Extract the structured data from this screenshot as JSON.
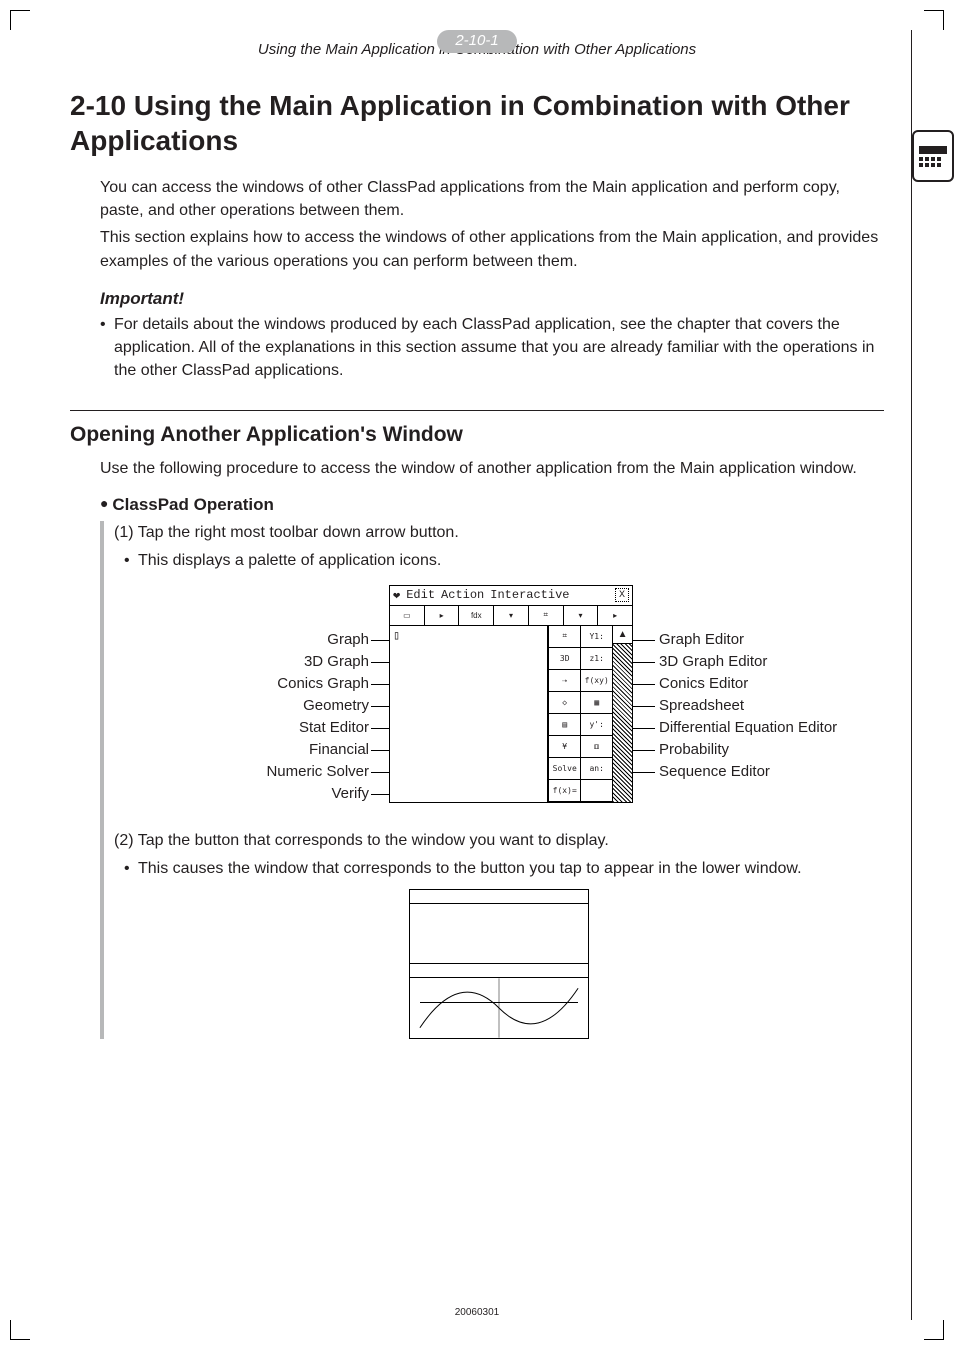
{
  "header": {
    "badge": "2-10-1",
    "subtitle": "Using the Main Application in Combination with Other Applications"
  },
  "title": {
    "number": "2-10",
    "text": "Using the Main Application in Combination with Other Applications"
  },
  "intro": {
    "p1": "You can access the windows of other ClassPad applications from the Main application and perform copy, paste, and other operations between them.",
    "p2": "This section explains how to access the windows of other applications from the Main application, and provides examples of the various operations you can perform between them."
  },
  "important": {
    "heading": "Important!",
    "bullet": "For details about the windows produced by each ClassPad application, see the chapter that covers the application. All of the explanations in this section assume that you are already familiar with the operations in the other ClassPad applications."
  },
  "subsection": {
    "heading": "Opening Another Application's Window",
    "lead": "Use the following procedure to access the window of another application from the Main application window.",
    "oper_heading": "ClassPad Operation",
    "step1": "(1) Tap the right most toolbar down arrow button.",
    "step1_sub": "This displays a palette of application icons.",
    "step2": "(2) Tap the button that corresponds to the window you want to display.",
    "step2_sub": "This causes the window that corresponds to the button you tap to appear in the lower window."
  },
  "diagram": {
    "menubar": {
      "edit": "Edit",
      "action": "Action",
      "interactive": "Interactive"
    },
    "left_labels": [
      "Graph",
      "3D Graph",
      "Conics Graph",
      "Geometry",
      "Stat Editor",
      "Financial",
      "Numeric Solver",
      "Verify"
    ],
    "right_labels": [
      "Graph Editor",
      "3D Graph Editor",
      "Conics Editor",
      "Spreadsheet",
      "Differential Equation Editor",
      "Probability",
      "Sequence Editor"
    ],
    "palette_cells": [
      [
        "⌗",
        "Y1:"
      ],
      [
        "3D",
        "z1:"
      ],
      [
        "⇢",
        "f(xy)"
      ],
      [
        "◇",
        "▦"
      ],
      [
        "▤",
        "y':"
      ],
      [
        "¥",
        "⚅"
      ],
      [
        "Solve",
        "an:"
      ],
      [
        "f(x)=",
        ""
      ]
    ]
  },
  "footer": {
    "code": "20060301"
  }
}
